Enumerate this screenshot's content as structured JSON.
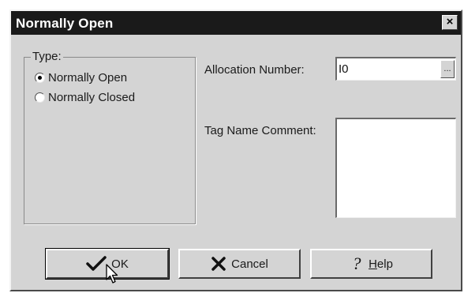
{
  "window": {
    "title": "Normally Open",
    "close_glyph": "×"
  },
  "type_group": {
    "label": "Type:",
    "options": [
      {
        "label": "Normally Open",
        "selected": true
      },
      {
        "label": "Normally Closed",
        "selected": false
      }
    ]
  },
  "allocation": {
    "label": "Allocation Number:",
    "value": "I0",
    "browse_label": "..."
  },
  "tag_comment": {
    "label": "Tag Name Comment:",
    "value": ""
  },
  "buttons": {
    "ok": {
      "label": "OK",
      "icon": "checkmark-icon"
    },
    "cancel": {
      "label": "Cancel",
      "icon": "x-icon"
    },
    "help": {
      "label_first": "H",
      "label_rest": "elp",
      "icon": "question-icon"
    }
  },
  "colors": {
    "title_bar": "#1a1a1a",
    "dialog_face": "#d4d4d4"
  }
}
